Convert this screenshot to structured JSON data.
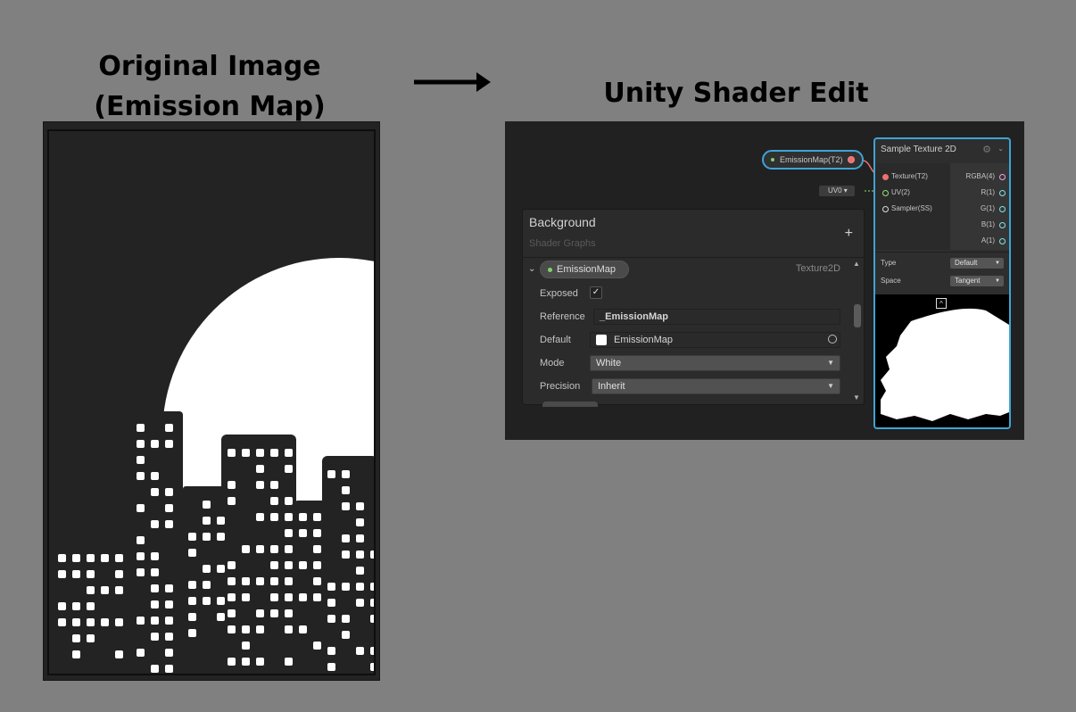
{
  "captions": {
    "left_line1": "Original Image",
    "left_line2": "(Emission Map)",
    "right": "Unity Shader Edit"
  },
  "graph": {
    "property_node_label": "EmissionMap(T2)",
    "uv_chip": "UV0 ▾"
  },
  "blackboard": {
    "title": "Background",
    "subtitle": "Shader Graphs",
    "add_icon": "plus-icon",
    "property": {
      "name": "EmissionMap",
      "type": "Texture2D",
      "exposed_label": "Exposed",
      "exposed_checked": true,
      "reference_label": "Reference",
      "reference_value": "_EmissionMap",
      "default_label": "Default",
      "default_value": "EmissionMap",
      "mode_label": "Mode",
      "mode_value": "White",
      "precision_label": "Precision",
      "precision_value": "Inherit"
    }
  },
  "sample_node": {
    "title": "Sample Texture 2D",
    "inputs": [
      "Texture(T2)",
      "UV(2)",
      "Sampler(SS)"
    ],
    "outputs": [
      "RGBA(4)",
      "R(1)",
      "G(1)",
      "B(1)",
      "A(1)"
    ],
    "type_label": "Type",
    "type_value": "Default",
    "space_label": "Space",
    "space_value": "Tangent"
  },
  "colors": {
    "background": "#808080",
    "node_selection": "#3ea4d6",
    "texture_port": "#ee7070",
    "vector_port": "#8fe36e",
    "float_port": "#84e4e7"
  }
}
